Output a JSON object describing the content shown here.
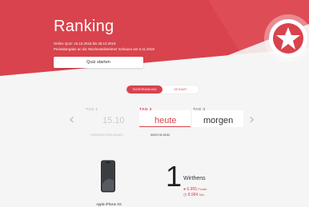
{
  "colors": {
    "accent": "#d9434d",
    "accent_dark": "#c73a44",
    "background": "#f5f5f5"
  },
  "hero": {
    "title": "Ranking",
    "line1": "Online Quiz: 15.10.2018 bis 28.10.2018",
    "line2": "Preisübergabe an die Wochenteilnehmer Schauen am 6.11.2018",
    "quiz_button": "Quiz starten",
    "badge_icon": "star-badge-icon"
  },
  "tabs": [
    {
      "label": "TAGESRANKING",
      "active": true
    },
    {
      "label": "GESAMT",
      "active": false
    }
  ],
  "days": {
    "prev_icon": "chevron-left-icon",
    "next_icon": "chevron-right-icon",
    "items": [
      {
        "label": "TAG 1",
        "value": "15.10",
        "sub": "GEWINNER ANSCHAUEN"
      },
      {
        "label": "TAG 2",
        "value": "heute",
        "sub": "NOCH 01:03:52"
      },
      {
        "label": "TAG 3",
        "value": "morgen",
        "sub": ""
      }
    ]
  },
  "prize": {
    "name": "Apple iPhone XS",
    "icon": "phone-icon"
  },
  "leader": {
    "rank": "1",
    "name": "Wirthens",
    "points": "6.955",
    "points_unit": "Punkte",
    "time": "8.984",
    "time_unit": "Sek."
  }
}
